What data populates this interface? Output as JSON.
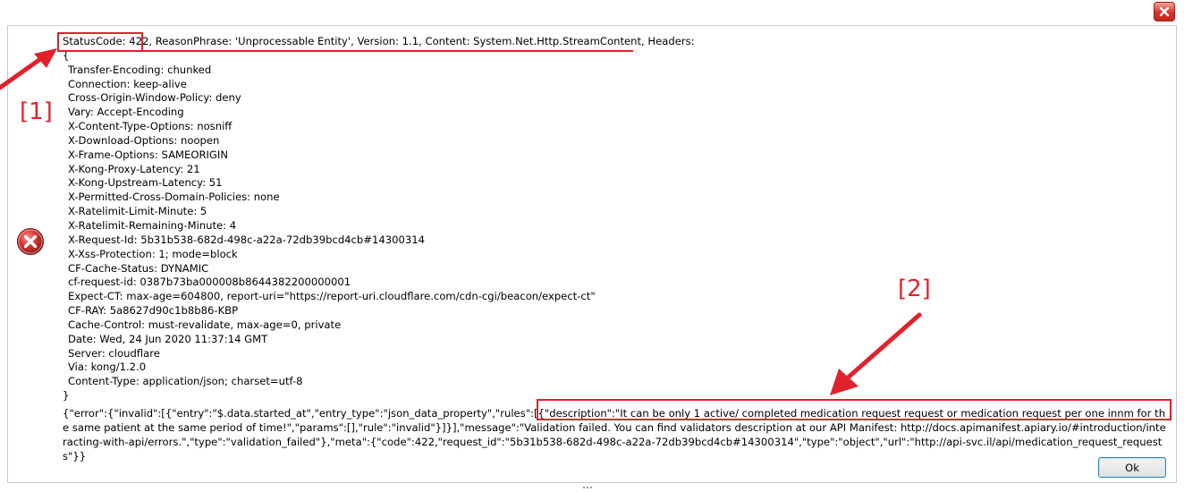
{
  "dialog": {
    "close_icon": "close-icon",
    "error_icon": "error-icon",
    "ok_label": "Ok"
  },
  "response": {
    "status_code": "StatusCode: 422",
    "status_rest": ", ReasonPhrase: 'Unprocessable Entity', Version: 1.1, Content: System.Net.Http.StreamContent, Headers:",
    "open_brace": "{",
    "close_brace": "}",
    "headers": [
      "Transfer-Encoding: chunked",
      "Connection: keep-alive",
      "Cross-Origin-Window-Policy: deny",
      "Vary: Accept-Encoding",
      "X-Content-Type-Options: nosniff",
      "X-Download-Options: noopen",
      "X-Frame-Options: SAMEORIGIN",
      "X-Kong-Proxy-Latency: 21",
      "X-Kong-Upstream-Latency: 51",
      "X-Permitted-Cross-Domain-Policies: none",
      "X-Ratelimit-Limit-Minute: 5",
      "X-Ratelimit-Remaining-Minute: 4",
      "X-Request-Id: 5b31b538-682d-498c-a22a-72db39bcd4cb#14300314",
      "X-Xss-Protection: 1; mode=block",
      "CF-Cache-Status: DYNAMIC",
      "cf-request-id: 0387b73ba000008b8644382200000001",
      "Expect-CT: max-age=604800, report-uri=\"https://report-uri.cloudflare.com/cdn-cgi/beacon/expect-ct\"",
      "CF-RAY: 5a8627d90c1b8b86-KBP",
      "Cache-Control: must-revalidate, max-age=0, private",
      "Date: Wed, 24 Jun 2020 11:37:14 GMT",
      "Server: cloudflare",
      "Via: kong/1.2.0",
      "Content-Type: application/json; charset=utf-8"
    ],
    "body_prefix": "{\"error\":{\"invalid\":[{\"entry\":\"$.data.started_at\",\"entry_type\":\"json_data_property\",\"rules\":[{\"description\":",
    "body_highlight": "\"It can be only 1 active/ completed medication request request or medication request per one innm for the same patient at the same",
    "body_suffix": " period of time!\",\"params\":[],\"rule\":\"invalid\"}]}],\"message\":\"Validation failed. You can find validators description at our API Manifest: http://docs.apimanifest.apiary.io/#introduction/interacting-with-api/errors.\",\"type\":\"validation_failed\"},\"meta\":{\"code\":422,\"request_id\":\"5b31b538-682d-498c-a22a-72db39bcd4cb#14300314\",\"type\":\"object\",\"url\":\"http://api-svc.il/api/medication_request_requests\"}}"
  },
  "annotations": {
    "label_1": "[1]",
    "label_2": "[2]",
    "color": "#e0222c"
  }
}
